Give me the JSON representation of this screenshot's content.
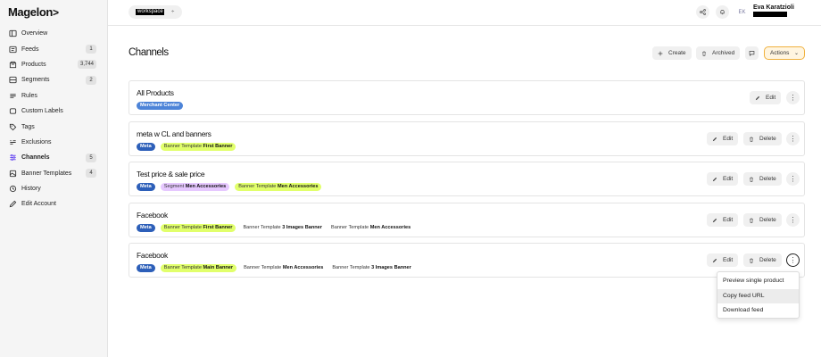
{
  "app": {
    "logo": "Magelon",
    "logo_mark": ">"
  },
  "sidebar": {
    "items": [
      {
        "label": "Overview",
        "icon": "sidebar-layout-icon"
      },
      {
        "label": "Feeds",
        "icon": "feed-icon",
        "badge": "1"
      },
      {
        "label": "Products",
        "icon": "product-icon",
        "badge": "3,744"
      },
      {
        "label": "Segments",
        "icon": "segment-icon",
        "badge": "2"
      },
      {
        "label": "Rules",
        "icon": "rules-icon"
      },
      {
        "label": "Custom Labels",
        "icon": "label-icon"
      },
      {
        "label": "Tags",
        "icon": "tag-icon"
      },
      {
        "label": "Exclusions",
        "icon": "exclusion-icon"
      },
      {
        "label": "Channels",
        "icon": "channels-icon",
        "badge": "5",
        "active": true
      },
      {
        "label": "Banner Templates",
        "icon": "banner-icon",
        "badge": "4"
      },
      {
        "label": "History",
        "icon": "history-icon"
      },
      {
        "label": "Edit Account",
        "icon": "pencil-icon"
      }
    ]
  },
  "topbar": {
    "workspace": "workspace",
    "caret": "÷",
    "avatar_initials": "EK",
    "user_name": "Eva Karatzioli",
    "user_email": "redacted"
  },
  "page": {
    "title": "Channels",
    "create_label": "Create",
    "archived_label": "Archived",
    "actions_label": "Actions",
    "actions_caret": "⌄"
  },
  "channels": [
    {
      "title": "All Products",
      "tags": [
        {
          "kind": "blue",
          "text": "Merchant Center"
        }
      ],
      "has_delete": false
    },
    {
      "title": "meta w CL and banners",
      "tags": [
        {
          "kind": "meta",
          "text": "Meta"
        },
        {
          "kind": "green",
          "prefix": "Banner Template",
          "text": "First Banner"
        }
      ],
      "has_delete": true
    },
    {
      "title": "Test price & sale price",
      "tags": [
        {
          "kind": "meta",
          "text": "Meta"
        },
        {
          "kind": "purple",
          "prefix": "Segment",
          "text": "Men Accessories"
        },
        {
          "kind": "green",
          "prefix": "Banner Template",
          "text": "Men Accessories"
        }
      ],
      "has_delete": true
    },
    {
      "title": "Facebook",
      "tags": [
        {
          "kind": "meta",
          "text": "Meta"
        },
        {
          "kind": "green",
          "prefix": "Banner Template",
          "text": "First Banner"
        },
        {
          "kind": "plain",
          "prefix": "Banner Template",
          "text": "3 Images Banner"
        },
        {
          "kind": "plain",
          "prefix": "Banner Template",
          "text": "Men Accessories"
        }
      ],
      "has_delete": true
    },
    {
      "title": "Facebook",
      "tags": [
        {
          "kind": "meta",
          "text": "Meta"
        },
        {
          "kind": "green",
          "prefix": "Banner Template",
          "text": "Main Banner"
        },
        {
          "kind": "plain",
          "prefix": "Banner Template",
          "text": "Men Accessories"
        },
        {
          "kind": "plain",
          "prefix": "Banner Template",
          "text": "3 Images Banner"
        }
      ],
      "has_delete": true
    }
  ],
  "card_labels": {
    "edit": "Edit",
    "delete": "Delete",
    "more": "⋮"
  },
  "dropdown": {
    "items": [
      {
        "label": "Preview single product"
      },
      {
        "label": "Copy feed URL",
        "hover": true
      },
      {
        "label": "Download feed"
      }
    ]
  }
}
